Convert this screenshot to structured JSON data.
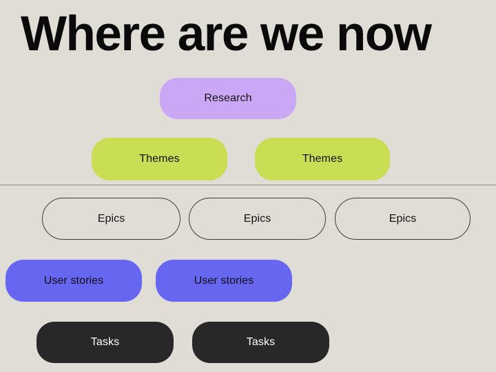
{
  "page": {
    "title": "Where are we now",
    "background_color": "#E0DDD7",
    "divider_color": "#8D8D8A"
  },
  "colors": {
    "research": "#CAA8F6",
    "theme": "#C9DD55",
    "epic_border": "#3B3B3B",
    "user_story": "#6666F0",
    "task": "#282828",
    "task_text": "#FFFFFF",
    "text": "#111111"
  },
  "rows": [
    {
      "level": "research",
      "chips": [
        {
          "label": "Research"
        }
      ]
    },
    {
      "level": "themes",
      "chips": [
        {
          "label": "Themes"
        },
        {
          "label": "Themes"
        }
      ]
    },
    {
      "level": "epics",
      "chips": [
        {
          "label": "Epics"
        },
        {
          "label": "Epics"
        },
        {
          "label": "Epics"
        }
      ]
    },
    {
      "level": "user_stories",
      "chips": [
        {
          "label": "User stories"
        },
        {
          "label": "User stories"
        }
      ]
    },
    {
      "level": "tasks",
      "chips": [
        {
          "label": "Tasks"
        },
        {
          "label": "Tasks"
        }
      ]
    }
  ]
}
